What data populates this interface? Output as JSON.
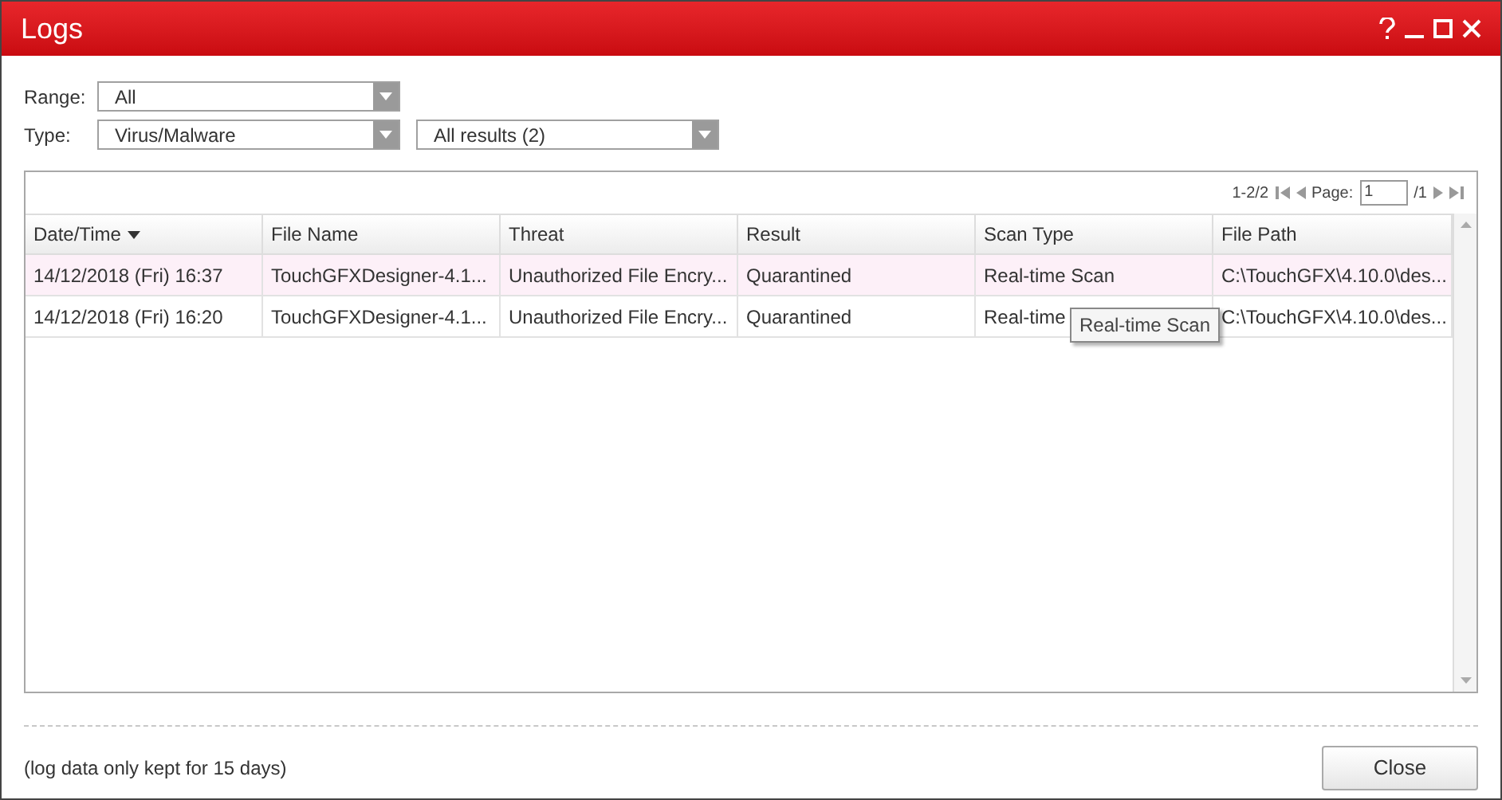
{
  "window": {
    "title": "Logs"
  },
  "filters": [
    {
      "label": "Range:",
      "dropdowns": [
        "All"
      ]
    },
    {
      "label": "Type:",
      "dropdowns": [
        "Virus/Malware",
        "All results (2)"
      ]
    }
  ],
  "pager": {
    "range": "1-2/2",
    "page_label": "Page:",
    "page": "1",
    "total": "/1"
  },
  "table": {
    "columns": [
      {
        "label": "Date/Time",
        "sorted": true
      },
      {
        "label": "File Name",
        "sorted": false
      },
      {
        "label": "Threat",
        "sorted": false
      },
      {
        "label": "Result",
        "sorted": false
      },
      {
        "label": "Scan Type",
        "sorted": false
      },
      {
        "label": "File Path",
        "sorted": false
      }
    ],
    "rows": [
      {
        "selected": true,
        "cells": [
          "14/12/2018 (Fri) 16:37",
          "TouchGFXDesigner-4.1...",
          "Unauthorized File Encry...",
          "Quarantined",
          "Real-time Scan",
          "C:\\TouchGFX\\4.10.0\\des..."
        ]
      },
      {
        "selected": false,
        "cells": [
          "14/12/2018 (Fri) 16:20",
          "TouchGFXDesigner-4.1...",
          "Unauthorized File Encry...",
          "Quarantined",
          "Real-time",
          "C:\\TouchGFX\\4.10.0\\des..."
        ]
      }
    ]
  },
  "tooltip": "Real-time Scan",
  "footer": {
    "note": "(log data only kept for 15 days)",
    "button": "Close"
  }
}
